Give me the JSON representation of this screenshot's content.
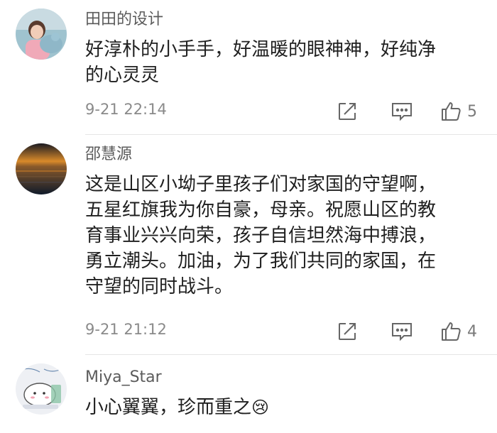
{
  "comments": [
    {
      "author": "田田的设计",
      "lines": [
        "好淳朴的小手手，好温暖的眼神神，好纯净",
        "的心灵灵"
      ],
      "time": "9-21 22:14",
      "likes": "5"
    },
    {
      "author": "邵慧源",
      "lines": [
        "这是山区小坳子里孩子们对家国的守望啊，",
        "五星红旗我为你自豪，母亲。祝愿山区的教",
        "育事业兴兴向荣，孩子自信坦然海中搏浪，",
        "勇立潮头。加油，为了我们共同的家国，在",
        "守望的同时战斗。"
      ],
      "time": "9-21 21:12",
      "likes": "4"
    },
    {
      "author": "Miya_Star",
      "text": "小心翼翼，珍而重之",
      "emoji": "😢"
    }
  ],
  "icons": {
    "share": "share-icon",
    "reply": "comment-icon",
    "like": "thumbs-up-icon"
  },
  "colors": {
    "text": "#1f1f1f",
    "author": "#5b5b5b",
    "meta": "#8a8a8a",
    "icon": "#666666"
  }
}
